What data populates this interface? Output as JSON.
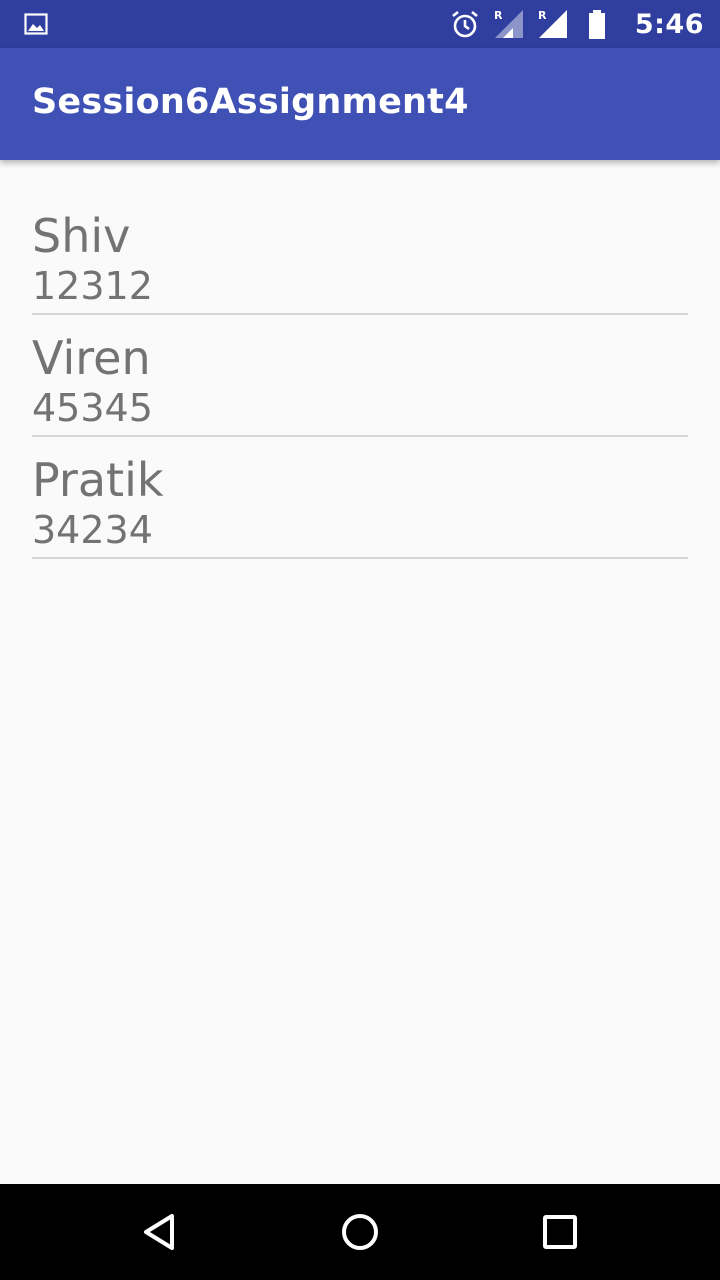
{
  "status_bar": {
    "time": "5:46",
    "left_icon": "image-icon",
    "right_icons": [
      "alarm-icon",
      "signal-roaming-icon",
      "signal-roaming-icon",
      "battery-icon"
    ]
  },
  "app_bar": {
    "title": "Session6Assignment4",
    "color": "#3f51b5"
  },
  "list": {
    "items": [
      {
        "name": "Shiv",
        "number": "12312"
      },
      {
        "name": "Viren",
        "number": "45345"
      },
      {
        "name": "Pratik",
        "number": "34234"
      }
    ]
  },
  "nav_bar": {
    "buttons": [
      "back-icon",
      "home-icon",
      "recents-icon"
    ]
  }
}
